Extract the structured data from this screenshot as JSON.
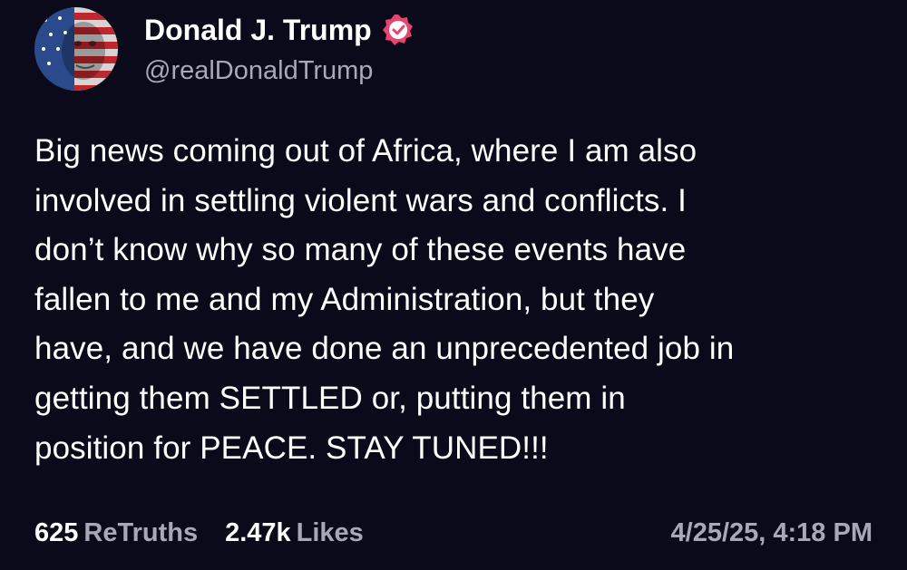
{
  "author": {
    "display_name": "Donald J. Trump",
    "handle": "@realDonaldTrump",
    "verified_icon": "verified-badge-icon",
    "avatar_icon": "avatar-flag-face"
  },
  "post": {
    "text": "Big news coming out of Africa, where I am also\ninvolved in settling violent wars and conflicts. I\ndon’t know why so many of these events have\nfallen to me and my Administration, but they\nhave, and we have done an unprecedented job in\ngetting them SETTLED or, putting them in\nposition for PEACE. STAY TUNED!!!"
  },
  "stats": {
    "retruths_count": "625",
    "retruths_label": "ReTruths",
    "likes_count": "2.47k",
    "likes_label": "Likes",
    "timestamp": "4/25/25, 4:18 PM"
  },
  "colors": {
    "background": "#0b0a1a",
    "text": "#ffffff",
    "muted": "#a9a8b8",
    "verified": "#e5456f"
  }
}
